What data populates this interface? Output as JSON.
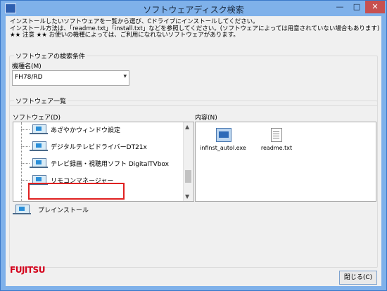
{
  "window": {
    "title": "ソフトウェアディスク検索",
    "minimize": "—",
    "maximize": "□",
    "close": "✕"
  },
  "intro": {
    "line1": "インストールしたいソフトウェアを一覧から選び、Cドライブにインストールしてください。",
    "line2": "インストール方法は、「readme.txt」「install.txt」などを参照してください。(ソフトウェアによっては用意されていない場合もあります)",
    "line3": "★★ 注意 ★★ お使いの機種によっては、ご利用になれないソフトウェアがあります。"
  },
  "search": {
    "legend": "ソフトウェアの検索条件",
    "model_label": "機種名(M)",
    "model_value": "FH78/RD"
  },
  "list": {
    "legend": "ソフトウェア一覧",
    "software_label": "ソフトウェア(D)",
    "content_label": "内容(N)",
    "items": [
      {
        "label": "あざやかウィンドウ設定"
      },
      {
        "label": "デジタルテレビドライバーDT21x"
      },
      {
        "label": "テレビ録画・視聴用ソフト DigitalTVbox"
      },
      {
        "label": "リモコンマネージャー"
      }
    ],
    "files": [
      {
        "name": "infinst_autol.exe",
        "icon": "exe-file-icon"
      },
      {
        "name": "readme.txt",
        "icon": "text-file-icon"
      }
    ],
    "preinstall": "プレインストール"
  },
  "footer": {
    "brand": "FUJITSU",
    "close_button": "閉じる(C)"
  },
  "colors": {
    "highlight": "#e02020",
    "brand": "#d4001b"
  }
}
